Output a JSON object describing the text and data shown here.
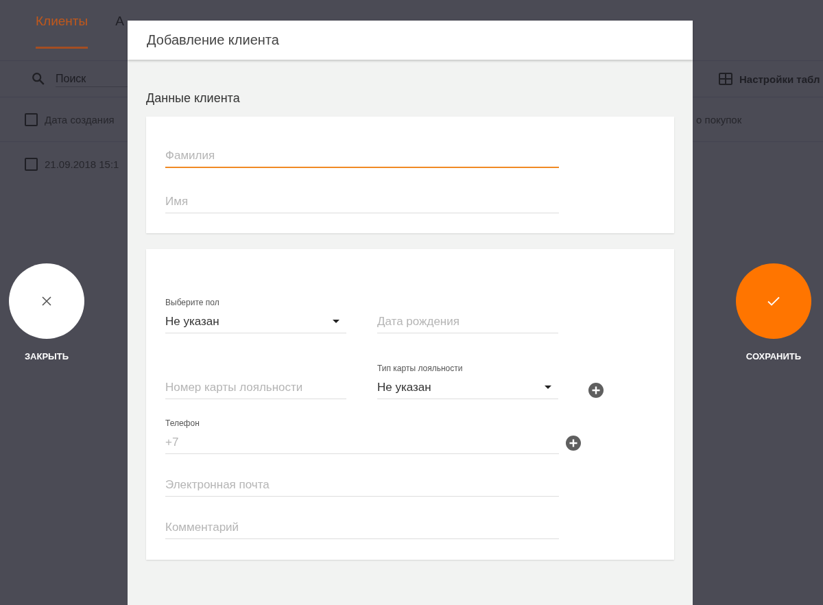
{
  "background": {
    "tabs": [
      {
        "label": "Клиенты",
        "selected": true
      },
      {
        "label": "А",
        "selected": false
      }
    ],
    "search": {
      "placeholder": "Поиск"
    },
    "table_settings": {
      "label": "Настройки табл"
    },
    "table": {
      "header_checked": false,
      "columns": [
        "Дата создания",
        "о покупок"
      ],
      "rows": [
        {
          "checked": false,
          "cells": [
            "21.09.2018 15:1"
          ]
        }
      ]
    }
  },
  "modal": {
    "title": "Добавление клиента",
    "section_title": "Данные клиента",
    "name_fields": [
      {
        "placeholder": "Фамилия",
        "focused": true
      },
      {
        "placeholder": "Имя",
        "focused": false
      }
    ],
    "rows": [
      {
        "add_button": false,
        "items": [
          {
            "kind": "select",
            "label": "Выберите пол",
            "value": "Не указан"
          },
          {
            "kind": "input",
            "placeholder": "Дата рождения"
          }
        ]
      },
      {
        "add_button": true,
        "items": [
          {
            "kind": "input",
            "placeholder": "Номер карты лояльности"
          },
          {
            "kind": "select",
            "label": "Тип карты лояльности",
            "value": "Не указан"
          }
        ]
      },
      {
        "add_button": true,
        "items": [
          {
            "kind": "input",
            "label": "Телефон",
            "placeholder": "+7"
          }
        ]
      },
      {
        "add_button": false,
        "items": [
          {
            "kind": "input",
            "placeholder": "Электронная почта"
          }
        ]
      },
      {
        "add_button": false,
        "items": [
          {
            "kind": "input",
            "placeholder": "Комментарий"
          }
        ]
      }
    ]
  },
  "close_button": {
    "label": "ЗАКРЫТЬ"
  },
  "save_button": {
    "label": "СОХРАНИТЬ"
  }
}
